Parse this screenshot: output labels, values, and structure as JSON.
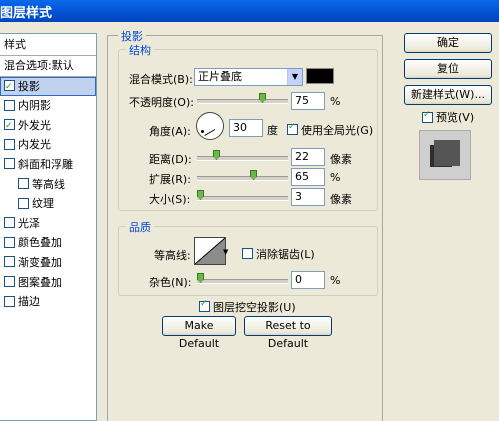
{
  "window": {
    "title": "图层样式"
  },
  "left_panel": {
    "header": "样式",
    "blend_options": "混合选项:默认",
    "items": [
      {
        "label": "投影",
        "checked": true,
        "selected": true
      },
      {
        "label": "内阴影",
        "checked": false
      },
      {
        "label": "外发光",
        "checked": true
      },
      {
        "label": "内发光",
        "checked": false
      },
      {
        "label": "斜面和浮雕",
        "checked": false
      },
      {
        "label": "等高线",
        "checked": false
      },
      {
        "label": "纹理",
        "checked": false
      },
      {
        "label": "光泽",
        "checked": false
      },
      {
        "label": "颜色叠加",
        "checked": false
      },
      {
        "label": "渐变叠加",
        "checked": false
      },
      {
        "label": "图案叠加",
        "checked": false
      },
      {
        "label": "描边",
        "checked": false
      }
    ]
  },
  "drop_shadow": {
    "section_title": "投影",
    "structure": {
      "title": "结构",
      "blend_mode_label": "混合模式(B):",
      "blend_mode_value": "正片叠底",
      "shadow_color": "#000000",
      "opacity_label": "不透明度(O):",
      "opacity_value": "75",
      "opacity_unit": "%",
      "angle_label": "角度(A):",
      "angle_value": "30",
      "angle_unit": "度",
      "global_light_label": "使用全局光(G)",
      "global_light_checked": true,
      "distance_label": "距离(D):",
      "distance_value": "22",
      "distance_unit": "像素",
      "spread_label": "扩展(R):",
      "spread_value": "65",
      "spread_unit": "%",
      "size_label": "大小(S):",
      "size_value": "3",
      "size_unit": "像素"
    },
    "quality": {
      "title": "品质",
      "contour_label": "等高线:",
      "anti_aliased_label": "消除锯齿(L)",
      "anti_aliased_checked": false,
      "noise_label": "杂色(N):",
      "noise_value": "0",
      "noise_unit": "%"
    },
    "knockout_label": "图层挖空投影(U)",
    "knockout_checked": true,
    "make_default_label": "Make Default",
    "reset_default_label": "Reset to Default"
  },
  "right_panel": {
    "ok_label": "确定",
    "reset_label": "复位",
    "new_style_label": "新建样式(W)...",
    "preview_label": "预览(V)",
    "preview_checked": true
  }
}
